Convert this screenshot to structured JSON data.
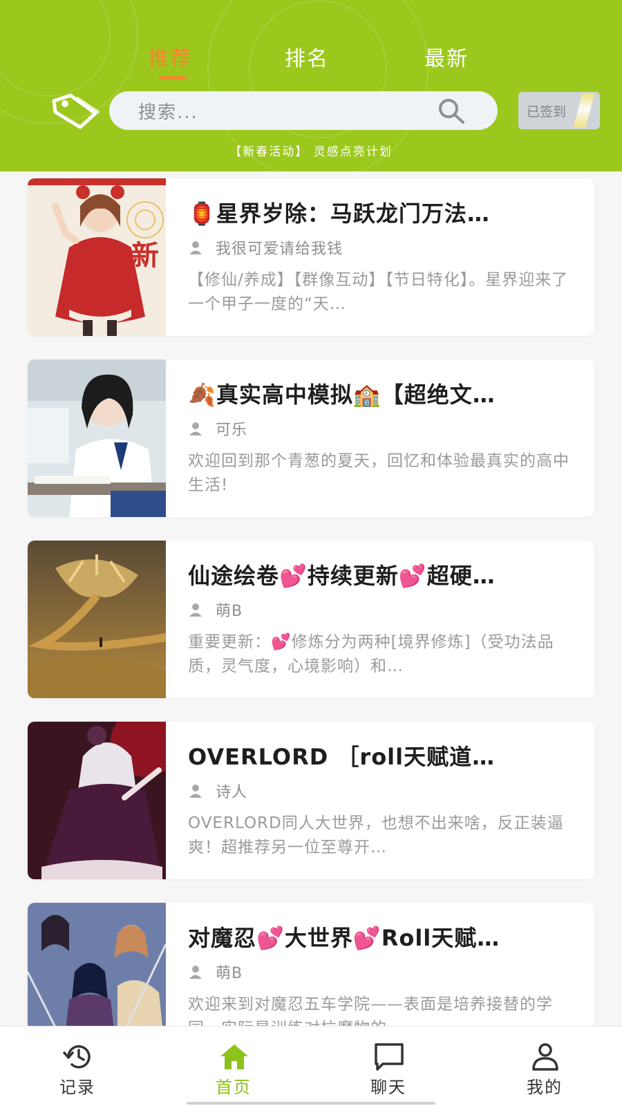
{
  "header": {
    "bg_color": "#9cc81e",
    "accent_color": "#f08a2b",
    "tabs": [
      {
        "label": "推荐",
        "active": true
      },
      {
        "label": "排名",
        "active": false
      },
      {
        "label": "最新",
        "active": false
      }
    ],
    "tag_icon": "tag-icon",
    "search": {
      "placeholder": "搜索...",
      "icon": "search-icon"
    },
    "checkin_label": "已签到",
    "activity_text": "【新春活动】 灵感点亮计划"
  },
  "list": [
    {
      "title": "🏮星界岁除：马跃龙门万法…",
      "author": "我很可爱请给我钱",
      "desc": "【修仙/养成】【群像互动】【节日特化】。星界迎来了一个甲子一度的“天…",
      "cover_theme": "red-festival-girl"
    },
    {
      "title": "🍂真实高中模拟🏫【超绝文…",
      "author": "可乐",
      "desc": "欢迎回到那个青葱的夏天，回忆和体验最真实的高中生活!",
      "cover_theme": "classroom-student"
    },
    {
      "title": "仙途绘卷💕持续更新💕超硬…",
      "author": "萌B",
      "desc": "重要更新：💕修炼分为两种[境界修炼]（受功法品质，灵气度，心境影响）和…",
      "cover_theme": "golden-dragon"
    },
    {
      "title": "OVERLORD ［roll天赋道…",
      "author": "诗人",
      "desc": "OVERLORD同人大世界，也想不出来啥，反正装逼爽！超推荐另一位至尊开…",
      "cover_theme": "gothic-vampire"
    },
    {
      "title": "对魔忍💕大世界💕Roll天赋…",
      "author": "萌B",
      "desc": "欢迎来到对魔忍五车学院——表面是培养接替的学园…实际是训练对抗魔物的…",
      "cover_theme": "anime-group"
    }
  ],
  "bottom_nav": [
    {
      "label": "记录",
      "icon": "history-icon",
      "active": false
    },
    {
      "label": "首页",
      "icon": "home-icon",
      "active": true
    },
    {
      "label": "聊天",
      "icon": "chat-icon",
      "active": false
    },
    {
      "label": "我的",
      "icon": "user-icon",
      "active": false
    }
  ],
  "nav_active_color": "#8cc31a"
}
